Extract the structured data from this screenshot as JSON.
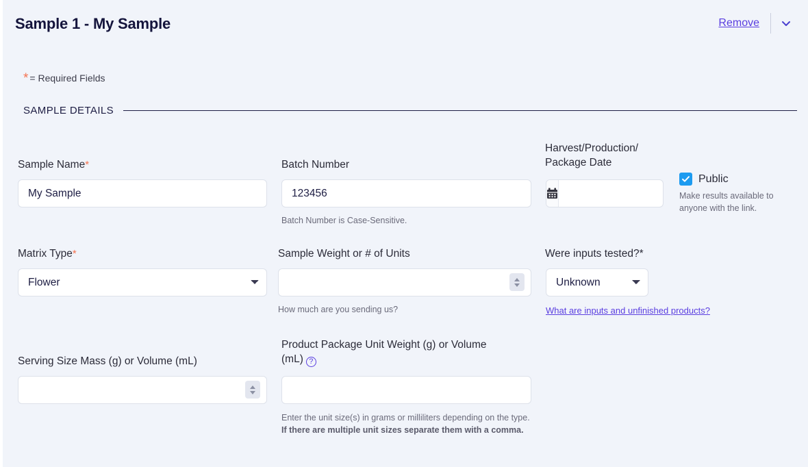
{
  "header": {
    "title": "Sample 1 - My Sample",
    "remove_label": "Remove",
    "collapse_icon": "chevron-down-icon"
  },
  "required_note": {
    "symbol": "*",
    "text": "= Required Fields"
  },
  "section": {
    "title": "SAMPLE DETAILS"
  },
  "fields": {
    "sample_name": {
      "label": "Sample Name",
      "required_marker": "*",
      "value": "My Sample",
      "placeholder": ""
    },
    "batch_number": {
      "label": "Batch Number",
      "value": "123456",
      "placeholder": "",
      "help": "Batch Number is Case-Sensitive."
    },
    "harvest_date": {
      "label_line1": "Harvest/Production/",
      "label_line2": "Package Date",
      "value": "",
      "placeholder": "",
      "icon": "calendar-icon"
    },
    "public": {
      "label": "Public",
      "checked": true,
      "description": "Make results available to anyone with the link."
    },
    "matrix_type": {
      "label": "Matrix Type",
      "required_marker": "*",
      "value": "Flower",
      "options": [
        "Flower"
      ]
    },
    "sample_weight": {
      "label": "Sample Weight or # of Units",
      "value": "",
      "placeholder": "",
      "help": "How much are you sending us?"
    },
    "inputs_tested": {
      "label": "Were inputs tested?*",
      "value": "Unknown",
      "options": [
        "Unknown"
      ],
      "link_text": "What are inputs and unfinished products?"
    },
    "serving_size": {
      "label": "Serving Size Mass (g) or Volume (mL)",
      "value": "",
      "placeholder": ""
    },
    "package_unit_weight": {
      "label_line1": "Product Package Unit Weight (g) or Volume",
      "label_line2": "(mL)",
      "help_icon": "question-circle-icon",
      "value": "",
      "placeholder": "",
      "help_plain": "Enter the unit size(s) in grams or milliliters depending on the type. ",
      "help_bold": "If there are multiple unit sizes separate them with a comma."
    }
  },
  "colors": {
    "background": "#f1f4fa",
    "title": "#14143c",
    "link": "#5a3ee0",
    "required_star": "#f4724f",
    "checkbox": "#1d9bf0",
    "input_border": "#dde1ea"
  }
}
